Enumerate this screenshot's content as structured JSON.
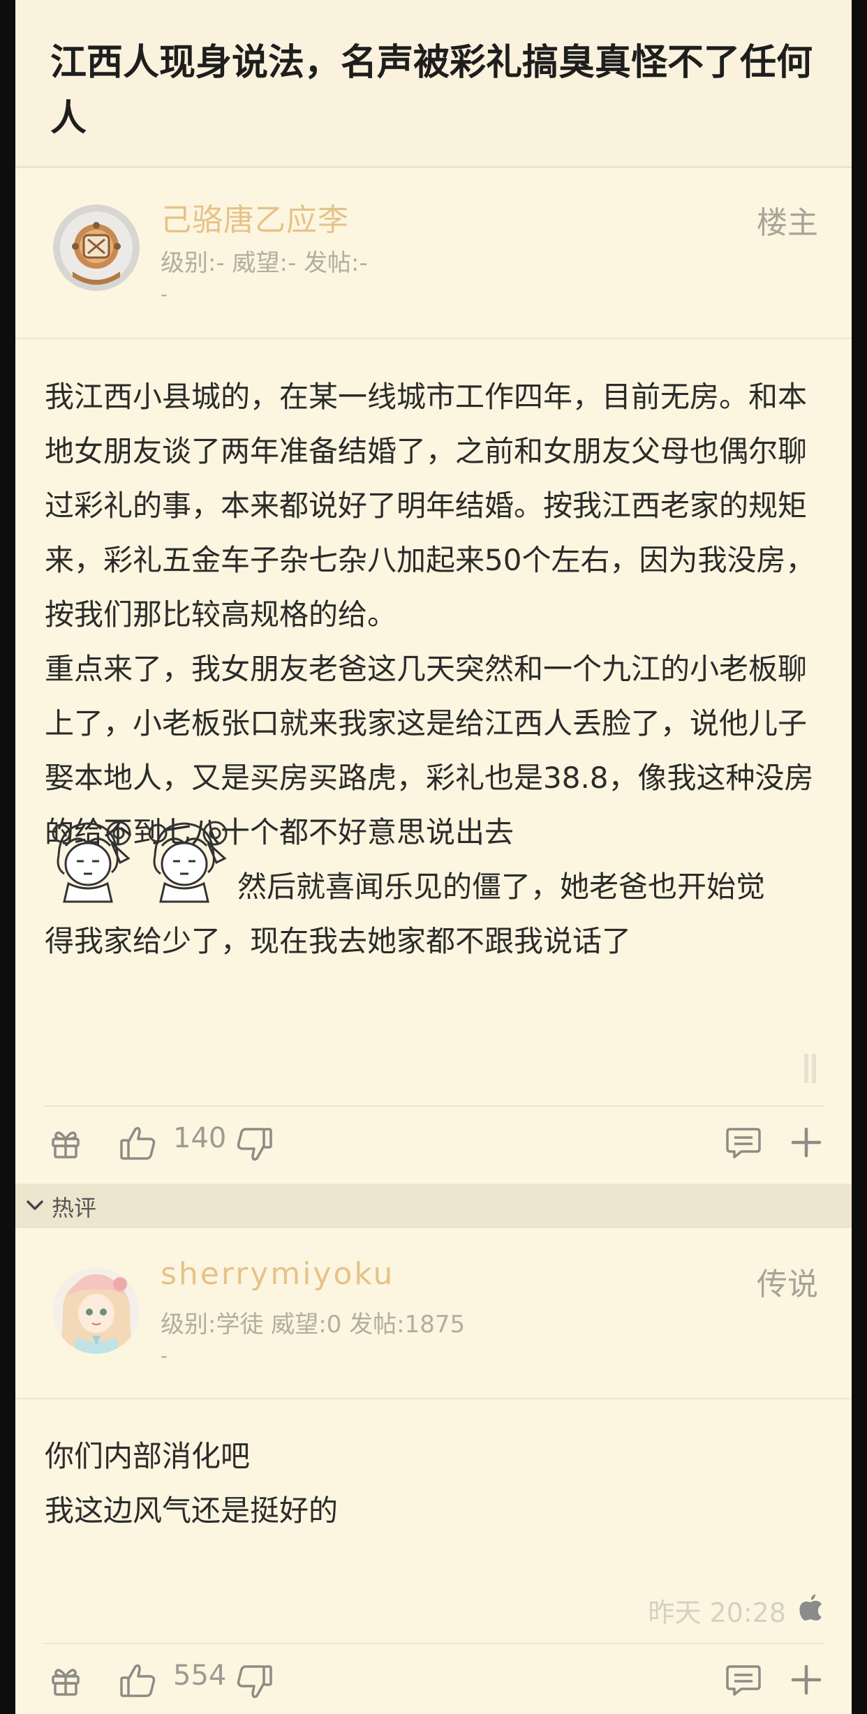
{
  "thread": {
    "title": "江西人现身说法，名声被彩礼搞臭真怪不了任何人"
  },
  "original_post": {
    "username": "己骆唐乙应李",
    "user_info": "级别:- 威望:- 发帖:-",
    "user_extra": "-",
    "role": "楼主",
    "paragraphs": [
      "我江西小县城的，在某一线城市工作四年，目前无房。和本地女朋友谈了两年准备结婚了，之前和女朋友父母也偶尔聊过彩礼的事，本来都说好了明年结婚。按我江西老家的规矩来，彩礼五金车子杂七杂八加起来50个左右，因为我没房，按我们那比较高规格的给。",
      "重点来了，我女朋友老爸这几天突然和一个九江的小老板聊上了，小老板张口就来我家这是给江西人丢脸了，说他儿子娶本地人，又是买房买路虎，彩礼也是38.8，像我这种没房的给不到七八十个都不好意思说出去"
    ],
    "emoji_line": "然后就喜闻乐见的僵了，她老爸也开始觉",
    "last_line": "得我家给少了，现在我去她家都不跟我说话了",
    "likes": "140"
  },
  "hot_section": {
    "label": "热评"
  },
  "hot_reply": {
    "username": "sherrymiyoku",
    "user_info": "级别:学徒 威望:0 发帖:1875",
    "user_extra": "-",
    "role": "传说",
    "lines": [
      "你们内部消化吧",
      "我这边风气还是挺好的"
    ],
    "time": "昨天 20:28",
    "likes": "554"
  },
  "icons": [
    "gift-icon",
    "thumb-up-icon",
    "thumb-down-icon",
    "comment-icon",
    "plus-icon",
    "chevron-down-icon",
    "apple-icon",
    "avatar-diving-helmet",
    "avatar-anime-girl",
    "sticker-anime-girl"
  ],
  "colors": {
    "background": "#fcf6e0",
    "username": "#e6c289",
    "muted": "#b1ada0",
    "text": "#2b2b2b",
    "hot_bar": "#ede5cd"
  }
}
